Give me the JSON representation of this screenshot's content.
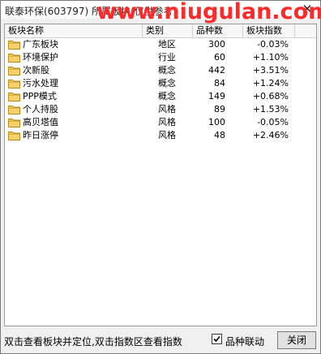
{
  "window": {
    "title": "联泰环保(603797)  所属板块(仅供参考)",
    "watermark": "www.niugulan.com"
  },
  "table": {
    "columns": [
      "板块名称",
      "类别",
      "品种数",
      "板块指数"
    ],
    "rows": [
      {
        "name": "广东板块",
        "category": "地区",
        "count": "300",
        "index": "-0.03%"
      },
      {
        "name": "环境保护",
        "category": "行业",
        "count": "60",
        "index": "+1.10%"
      },
      {
        "name": "次新股",
        "category": "概念",
        "count": "442",
        "index": "+3.51%"
      },
      {
        "name": "污水处理",
        "category": "概念",
        "count": "84",
        "index": "+1.24%"
      },
      {
        "name": "PPP模式",
        "category": "概念",
        "count": "149",
        "index": "+0.68%"
      },
      {
        "name": "个人持股",
        "category": "风格",
        "count": "89",
        "index": "+1.53%"
      },
      {
        "name": "高贝塔值",
        "category": "风格",
        "count": "100",
        "index": "-0.05%"
      },
      {
        "name": "昨日涨停",
        "category": "风格",
        "count": "48",
        "index": "+2.46%"
      }
    ]
  },
  "footer": {
    "status": "双击查看板块并定位,双击指数区查看指数",
    "checkbox_label": "品种联动",
    "checkbox_checked": true,
    "close_label": "关闭"
  },
  "colors": {
    "folder_fill": "#f5d36a",
    "folder_stroke": "#b98a1e",
    "watermark": "#ff2a2a"
  }
}
